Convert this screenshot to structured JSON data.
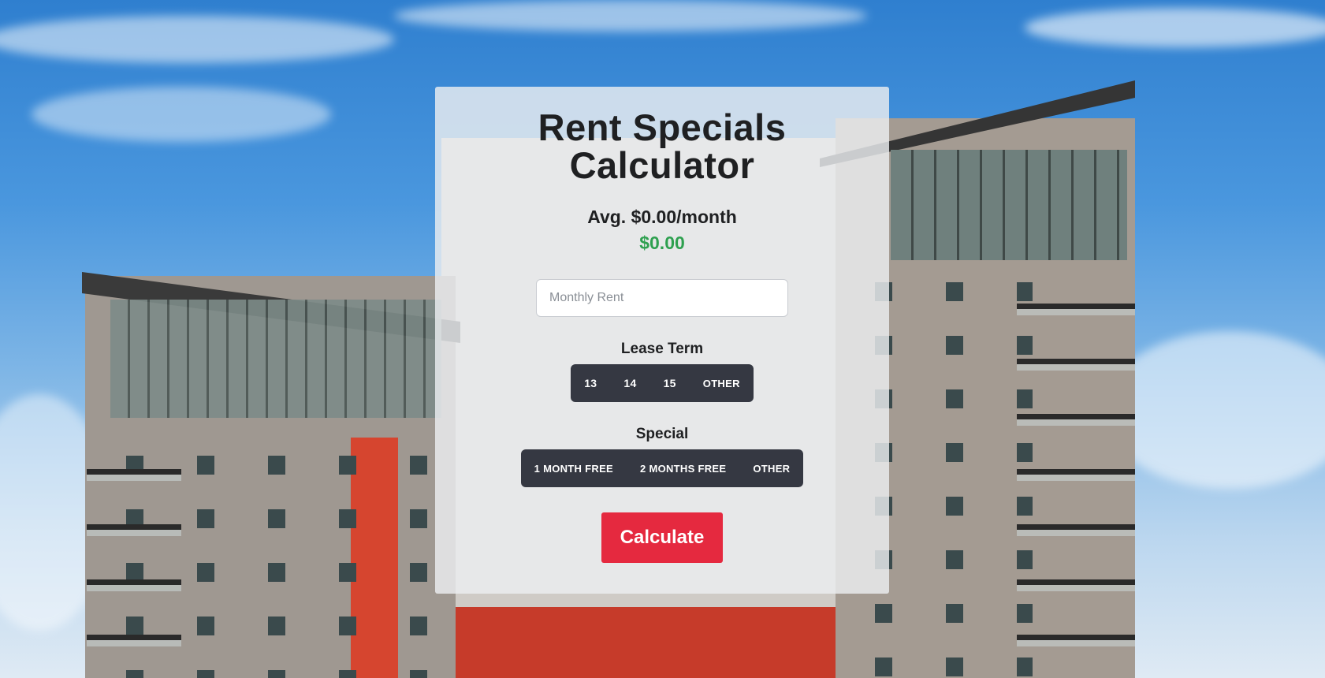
{
  "page": {
    "title_line1": "Rent Specials",
    "title_line2": "Calculator"
  },
  "results": {
    "average_monthly": "Avg. $0.00/month",
    "total": "$0.00"
  },
  "monthly_rent_input": {
    "placeholder": "Monthly Rent",
    "value": ""
  },
  "lease_term": {
    "label": "Lease Term",
    "options": [
      "13",
      "14",
      "15",
      "OTHER"
    ]
  },
  "special": {
    "label": "Special",
    "options": [
      "1 MONTH FREE",
      "2 MONTHS FREE",
      "OTHER"
    ]
  },
  "calculate_button": "Calculate",
  "colors": {
    "accent_red": "#e5293f",
    "total_green": "#2ea04f",
    "button_group_dark": "#353842"
  },
  "background": "photo of apartment buildings under blue sky"
}
